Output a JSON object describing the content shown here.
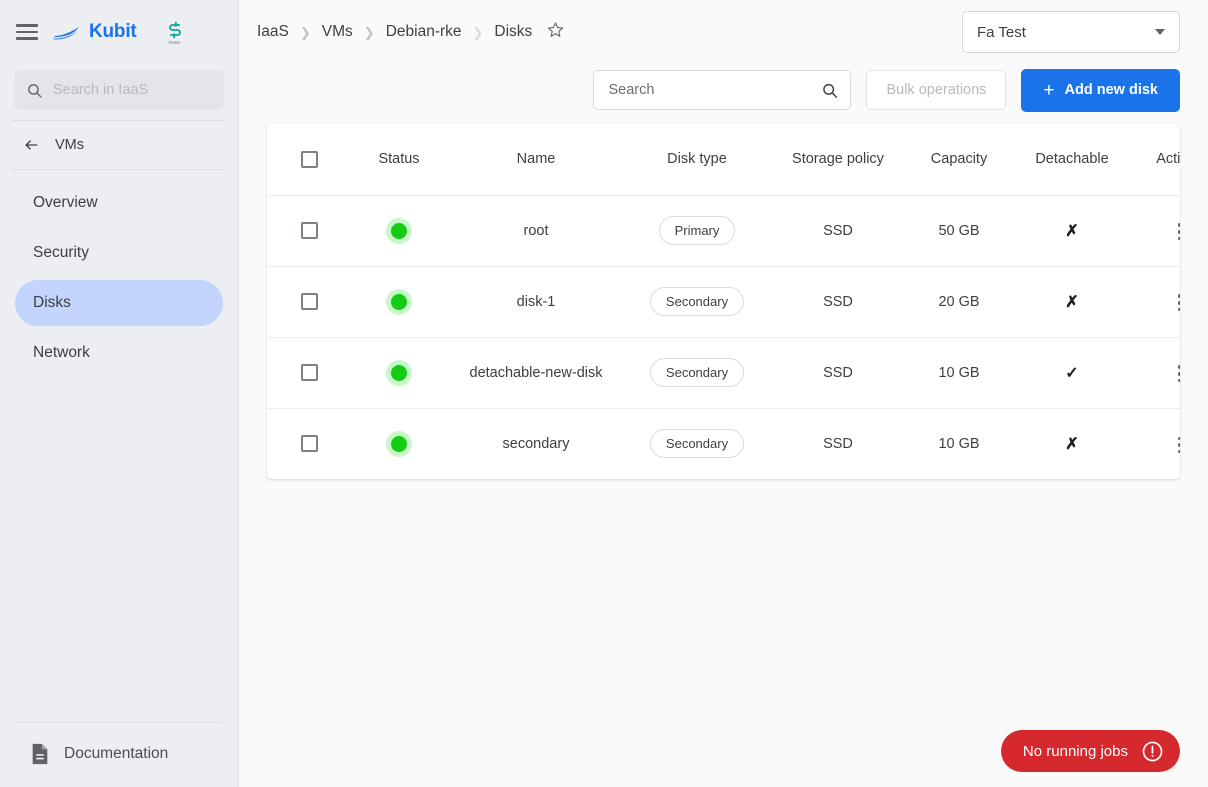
{
  "colors": {
    "accent_blue": "#1a73e8",
    "sidebar_bg": "#eceef1",
    "selected_item_bg": "#c3d4fd",
    "status_green": "#14cc14",
    "toast_red": "#d6292e"
  },
  "sidebar": {
    "brand": {
      "name": "Kubit",
      "mark_icon": "boat-logo-icon"
    },
    "partner_logo": {
      "icon": "partner-s-logo-icon",
      "caption": "Presse"
    },
    "menu_icon": "hamburger-menu-icon",
    "search": {
      "placeholder": "Search in IaaS",
      "value": "",
      "icon": "search-icon"
    },
    "back": {
      "label": "VMs",
      "icon": "arrow-left-icon"
    },
    "items": [
      {
        "label": "Overview",
        "selected": false
      },
      {
        "label": "Security",
        "selected": false
      },
      {
        "label": "Disks",
        "selected": true
      },
      {
        "label": "Network",
        "selected": false
      }
    ],
    "footer": {
      "label": "Documentation",
      "icon": "document-icon"
    }
  },
  "topbar": {
    "breadcrumbs": [
      "IaaS",
      "VMs",
      "Debian-rke",
      "Disks"
    ],
    "favorite_icon": "star-outline-icon",
    "account_select": {
      "value": "Fa Test",
      "icon": "chevron-down-icon"
    }
  },
  "actionbar": {
    "search": {
      "placeholder": "Search",
      "value": "",
      "icon": "search-icon"
    },
    "bulk_operations_label": "Bulk operations",
    "add_new_disk_label": "Add new disk",
    "add_icon": "plus-icon"
  },
  "table": {
    "select_all_checkbox": false,
    "columns": [
      "Status",
      "Name",
      "Disk type",
      "Storage policy",
      "Capacity",
      "Detachable",
      "Actions"
    ],
    "rows": [
      {
        "checked": false,
        "status": "running",
        "name": "root",
        "disk_type": "Primary",
        "storage_policy": "SSD",
        "capacity": "50 GB",
        "detachable": "✗",
        "actions_icon": "kebab-menu-icon"
      },
      {
        "checked": false,
        "status": "running",
        "name": "disk-1",
        "disk_type": "Secondary",
        "storage_policy": "SSD",
        "capacity": "20 GB",
        "detachable": "✗",
        "actions_icon": "kebab-menu-icon"
      },
      {
        "checked": false,
        "status": "running",
        "name": "detachable-new-disk",
        "disk_type": "Secondary",
        "storage_policy": "SSD",
        "capacity": "10 GB",
        "detachable": "✓",
        "actions_icon": "kebab-menu-icon"
      },
      {
        "checked": false,
        "status": "running",
        "name": "secondary",
        "disk_type": "Secondary",
        "storage_policy": "SSD",
        "capacity": "10 GB",
        "detachable": "✗",
        "actions_icon": "kebab-menu-icon"
      }
    ]
  },
  "toast": {
    "label": "No running jobs",
    "icon": "exclamation-circle-icon"
  }
}
